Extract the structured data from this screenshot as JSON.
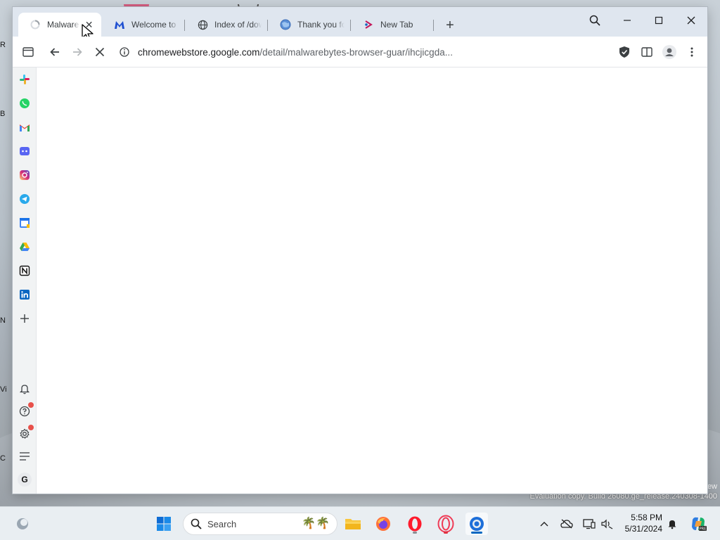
{
  "desktop": {
    "evaluation_text": "Evaluation copy. Build 26080.ge_release.240308-1400",
    "right_fragment": "ew",
    "left_fragments": [
      "R",
      "B",
      "N",
      "Vi",
      "C"
    ]
  },
  "browser": {
    "tabs": [
      {
        "title": "Malwarebytes",
        "active": true,
        "loading": true
      },
      {
        "title": "Welcome to Malwarebytes",
        "active": false
      },
      {
        "title": "Index of /downloads",
        "active": false
      },
      {
        "title": "Thank you for downloading",
        "active": false
      },
      {
        "title": "New Tab",
        "active": false
      }
    ],
    "omnibox": {
      "host": "chromewebstore.google.com",
      "path": "/detail/malwarebytes-browser-guar/ihcjicgda..."
    },
    "sidebar_icons": [
      "slack-icon",
      "whatsapp-icon",
      "gmail-icon",
      "discord-icon",
      "instagram-icon",
      "telegram-icon",
      "calendar-icon",
      "drive-icon",
      "notion-icon",
      "linkedin-icon",
      "add-icon"
    ],
    "sidebar_bottom_icons": [
      "bell-icon",
      "help-icon",
      "settings-icon",
      "menu-icon",
      "account-g-icon"
    ],
    "account_initial": "G"
  },
  "taskbar": {
    "search_placeholder": "Search",
    "time": "5:58 PM",
    "date": "5/31/2024"
  }
}
